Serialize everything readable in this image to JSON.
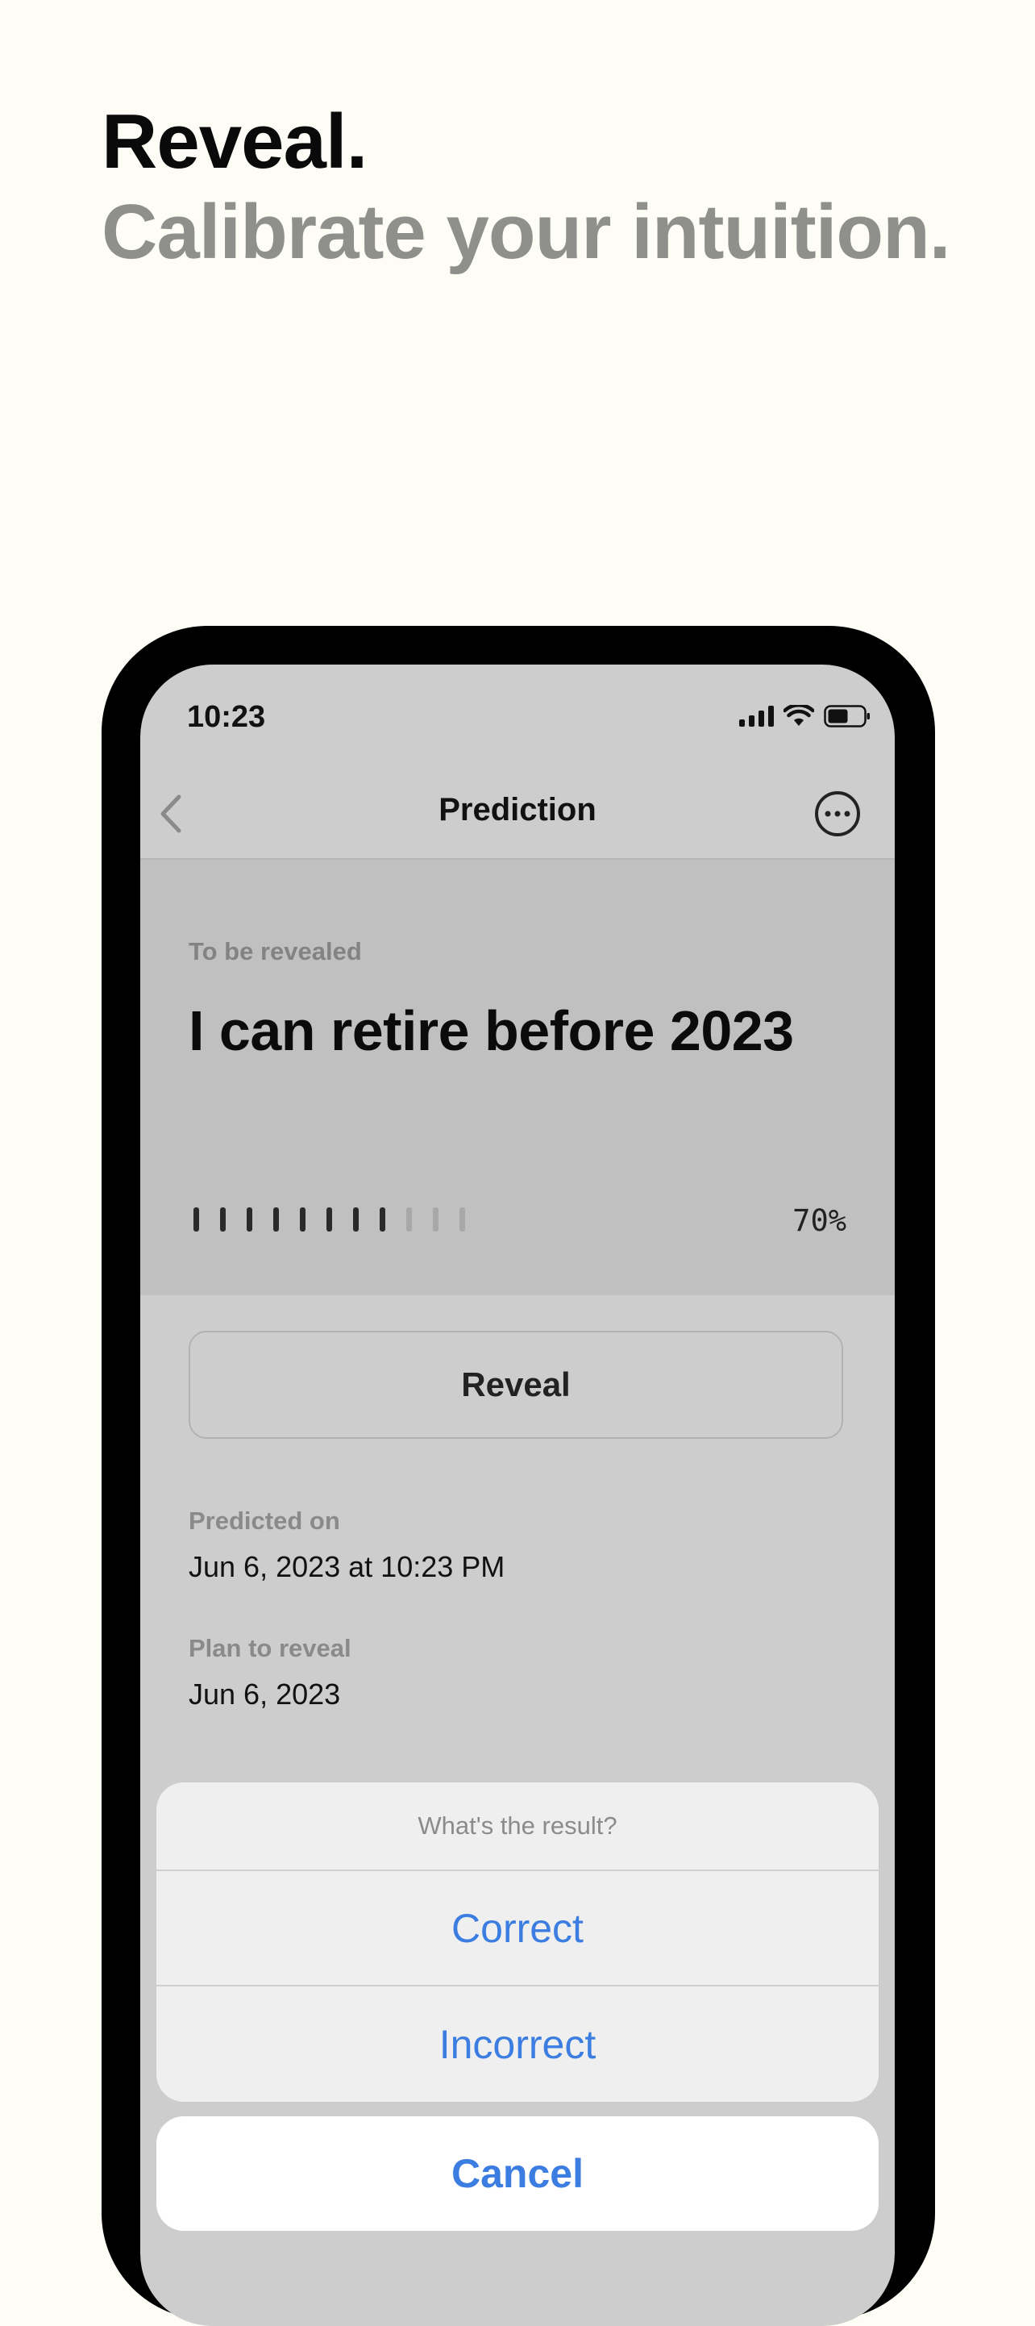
{
  "headline": {
    "line1": "Reveal.",
    "line2": "Calibrate your intuition."
  },
  "status_bar": {
    "time": "10:23"
  },
  "nav": {
    "title": "Prediction",
    "back_icon": "chevron-left-icon",
    "more_icon": "ellipsis-circle-icon"
  },
  "prediction": {
    "status": "To be revealed",
    "statement": "I can retire before 2023",
    "confidence_label": "70%",
    "confidence": 0.7
  },
  "reveal_button": "Reveal",
  "details": {
    "predicted_on_label": "Predicted on",
    "predicted_on_value": "Jun 6, 2023 at 10:23 PM",
    "plan_label": "Plan to reveal",
    "plan_value": "Jun 6, 2023"
  },
  "action_sheet": {
    "title": "What's the result?",
    "options": [
      "Correct",
      "Incorrect"
    ],
    "cancel": "Cancel"
  },
  "colors": {
    "background": "#fdfcf5",
    "accent": "#3b7de0",
    "headline_secondary": "#8f8f8c"
  }
}
